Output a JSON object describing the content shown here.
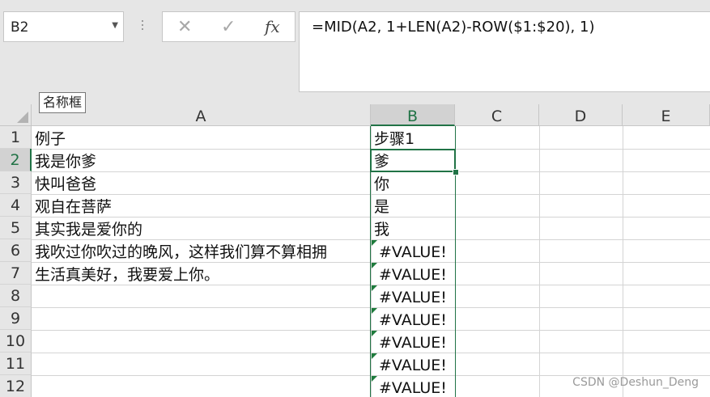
{
  "namebox": {
    "value": "B2"
  },
  "formula_bar": {
    "cancel_icon": "✕",
    "enter_icon": "✓",
    "fx_label": "fx",
    "formula": "=MID(A2, 1+LEN(A2)-ROW($1:$20), 1)"
  },
  "tooltip": "名称框",
  "columns": [
    "A",
    "B",
    "C",
    "D",
    "E"
  ],
  "rows": [
    "1",
    "2",
    "3",
    "4",
    "5",
    "6",
    "7",
    "8",
    "9",
    "10",
    "11",
    "12"
  ],
  "cells": {
    "A": [
      "例子",
      "我是你爹",
      "快叫爸爸",
      "观自在菩萨",
      "其实我是爱你的",
      "我吹过你吹过的晚风，这样我们算不算相拥",
      "生活真美好，我要爱上你。"
    ],
    "B": [
      "步骤1",
      "爹",
      "你",
      "是",
      "我",
      "#VALUE!",
      "#VALUE!",
      "#VALUE!",
      "#VALUE!",
      "#VALUE!",
      "#VALUE!",
      "#VALUE!"
    ]
  },
  "watermark": "CSDN @Deshun_Deng"
}
